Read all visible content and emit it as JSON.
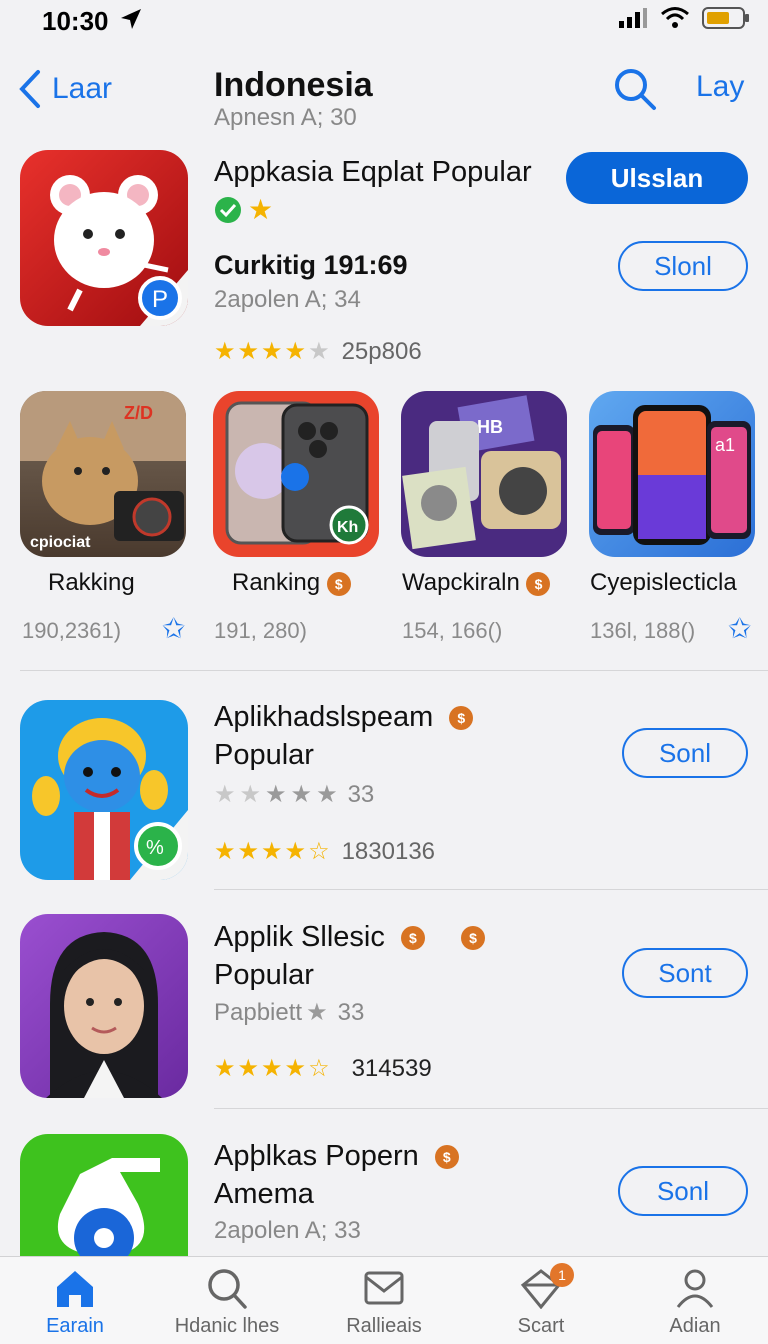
{
  "status_bar": {
    "time": "10:30"
  },
  "nav": {
    "back_label": "Laar",
    "title": "Indonesia",
    "subtitle": "Apnesn A; 30",
    "right_label": "Lay"
  },
  "featured": {
    "title": "Appkasia Eqplat Popular",
    "subtitle": "Curkitig 191:69",
    "meta": "2apolen A; 34",
    "rating_count": "25p806",
    "primary_button": "Ulsslan",
    "secondary_button": "Slonl",
    "rating": 3.5
  },
  "ranking": [
    {
      "name": "Rakking",
      "count": "190,2361)",
      "icon_text": "cpiociat",
      "icon_corner_text": "Z/D"
    },
    {
      "name": "Ranking",
      "count": "191, 280)",
      "badge_text": "Kh"
    },
    {
      "name": "Wapckiraln",
      "count": "154, 166()",
      "icon_text": "HB"
    },
    {
      "name": "Cyepislecticla",
      "count": "136l, 188()",
      "icon_text": "a1"
    }
  ],
  "apps": [
    {
      "title_line1": "Aplikhadslspeam",
      "title_line2": "Popular",
      "meta": "33",
      "rating_count": "1830136",
      "button": "Sonl",
      "rating": 3.5
    },
    {
      "title_line1": "Applik Sllesic",
      "title_line2": "Popular",
      "meta_prefix": "Papbiett",
      "meta": "33",
      "rating_count": "314539",
      "button": "Sont",
      "rating": 3.5
    },
    {
      "title_line1": "Apþlkas Popern",
      "title_line2": "Amema",
      "meta": "2apolen A; 33",
      "button": "Sonl"
    }
  ],
  "tabs": [
    {
      "label": "Earain",
      "icon": "home-icon",
      "active": true
    },
    {
      "label": "Hdanic lhes",
      "icon": "search-icon"
    },
    {
      "label": "Rallieais",
      "icon": "mail-icon"
    },
    {
      "label": "Scart",
      "icon": "scart-icon",
      "badge": "1"
    },
    {
      "label": "Adian",
      "icon": "person-icon"
    }
  ],
  "colors": {
    "accent": "#1a73e8",
    "primary_button": "#0a66d8",
    "star": "#f5b301",
    "coin": "#d87322"
  }
}
